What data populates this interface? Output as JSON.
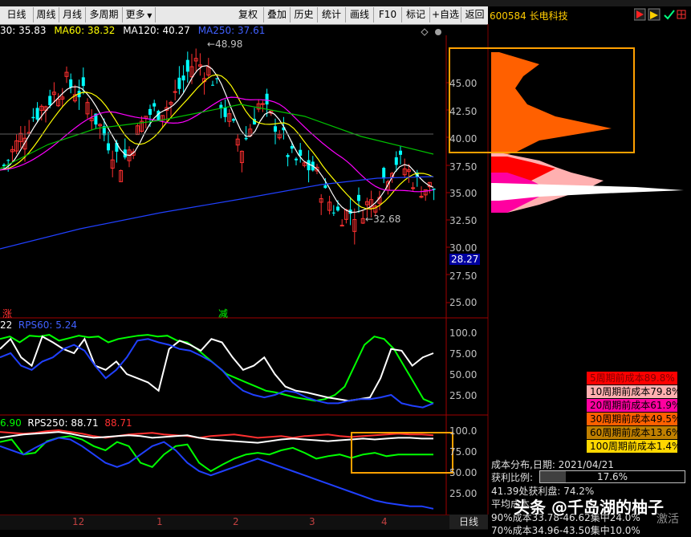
{
  "toolbar": {
    "buttons": [
      "日线",
      "周线",
      "月线",
      "多周期",
      "更多",
      "复权",
      "叠加",
      "历史",
      "统计",
      "画线",
      "F10",
      "标记",
      "+自选",
      "返回"
    ]
  },
  "stock": {
    "code": "600584",
    "name": "长电科技"
  },
  "ma_row": {
    "ma30": "30: 35.83",
    "ma60": "MA60: 38.32",
    "ma120": "MA120: 40.27",
    "ma250": "MA250: 37.61"
  },
  "price_axis": [
    "45.00",
    "42.50",
    "40.00",
    "37.50",
    "35.00",
    "32.50",
    "30.00",
    "27.50",
    "25.00"
  ],
  "price_labels": {
    "high": "48.98",
    "low": "32.68",
    "current": "28.27"
  },
  "chart_marks": {
    "zhang": "涨",
    "jian": "减"
  },
  "rps60": {
    "label1": "22",
    "label2": "RPS60: 5.24",
    "axis": [
      "100.0",
      "75.00",
      "50.00",
      "25.00"
    ]
  },
  "rps250": {
    "label1": "6.90",
    "label2": "RPS250: 88.71",
    "label3": "88.71",
    "axis": [
      "100.0",
      "75.00",
      "50.00",
      "25.00"
    ]
  },
  "cost_legend": [
    {
      "text": "5周期前成本89.8%",
      "bg": "#ff0000",
      "fg": "#800000"
    },
    {
      "text": "10周期前成本79.8%",
      "bg": "#ffb0b0",
      "fg": "#000000"
    },
    {
      "text": "20周期前成本61.9%",
      "bg": "#ff00a0",
      "fg": "#000000"
    },
    {
      "text": "30周期前成本49.5%",
      "bg": "#ff6000",
      "fg": "#000000"
    },
    {
      "text": "60周期前成本13.6%",
      "bg": "#c08000",
      "fg": "#000000"
    },
    {
      "text": "100周期前成本1.4%",
      "bg": "#ffd700",
      "fg": "#000000"
    }
  ],
  "cost_info": {
    "date_line": "成本分布,日期:  2021/04/21",
    "profit_label": "获利比例:",
    "profit_value": "17.6%",
    "profit_fraction": 0.176,
    "line3": "41.39处获利盘: 74.2%",
    "line4": "平均成本",
    "line5": "90%成本33.78-46.62集中24.0%",
    "line6": "70%成本34.96-43.50集中10.0%"
  },
  "x_axis": [
    "12",
    "1",
    "2",
    "3",
    "4"
  ],
  "day_button": "日线",
  "watermark": "头条 @千岛湖的柚子",
  "activate": "激活",
  "colors": {
    "up": "#ff3030",
    "down": "#00ffff",
    "ma5": "#ffffff",
    "ma10": "#ffff00",
    "ma20": "#ff00ff",
    "ma60": "#00c000",
    "ma250": "#2040ff",
    "highlight": "#ffa000"
  }
}
